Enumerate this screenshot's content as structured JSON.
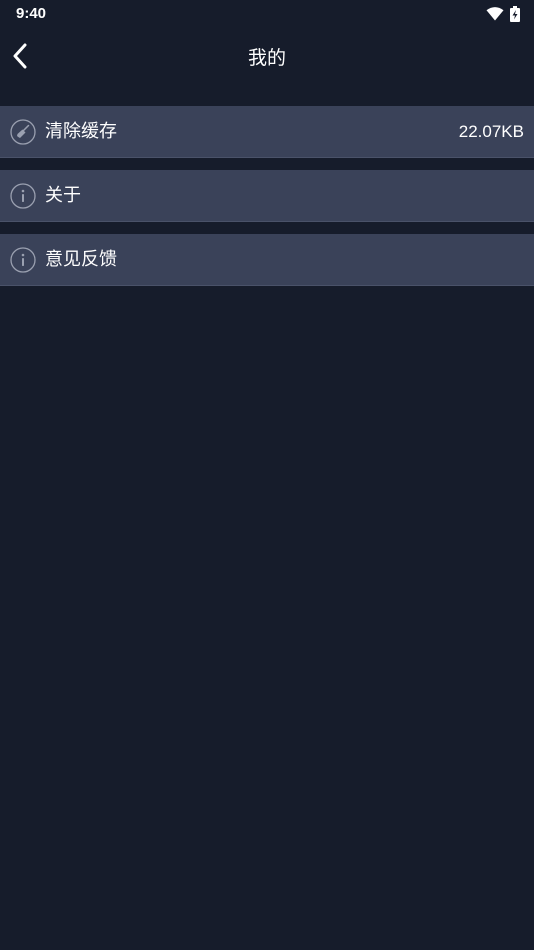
{
  "status_bar": {
    "time": "9:40",
    "icons": [
      "wifi-icon",
      "battery-charging-icon"
    ]
  },
  "app_bar": {
    "back_icon": "chevron-left-icon",
    "title": "我的"
  },
  "settings": {
    "items": [
      {
        "label": "清除缓存",
        "value": "22.07KB",
        "icon": "broom-icon"
      },
      {
        "label": "关于",
        "icon": "info-icon"
      },
      {
        "label": "意见反馈",
        "icon": "info-icon"
      }
    ]
  },
  "colors": {
    "background": "#161c2b",
    "row_background": "#3a4259",
    "text": "#ffffff",
    "icon_stroke": "#9aa0b0"
  }
}
